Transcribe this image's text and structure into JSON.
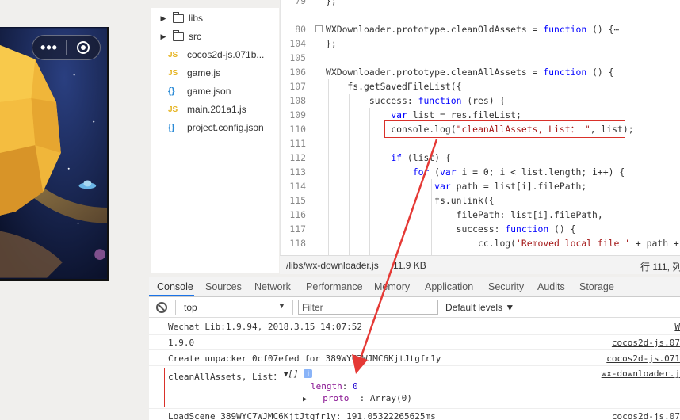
{
  "file_tree": [
    {
      "type": "folder",
      "name": "libs",
      "icon": "folder-icon"
    },
    {
      "type": "folder",
      "name": "src",
      "icon": "folder-icon"
    },
    {
      "type": "js",
      "name": "cocos2d-js.071b...",
      "badge": "JS"
    },
    {
      "type": "js",
      "name": "game.js",
      "badge": "JS"
    },
    {
      "type": "json",
      "name": "game.json",
      "badge": "{}"
    },
    {
      "type": "js",
      "name": "main.201a1.js",
      "badge": "JS"
    },
    {
      "type": "json",
      "name": "project.config.json",
      "badge": "{}"
    }
  ],
  "editor": {
    "lines": [
      {
        "n": "79",
        "code": "};"
      },
      {
        "n": "80",
        "code": "WXDownloader.prototype.cleanOldAssets = function () {⋯"
      },
      {
        "n": "104",
        "code": "};"
      },
      {
        "n": "105",
        "code": ""
      },
      {
        "n": "106",
        "code": "WXDownloader.prototype.cleanAllAssets = function () {"
      },
      {
        "n": "107",
        "code": "    fs.getSavedFileList({"
      },
      {
        "n": "108",
        "code": "        success: function (res) {"
      },
      {
        "n": "109",
        "code": "            var list = res.fileList;"
      },
      {
        "n": "110",
        "code": "            console.log(\"cleanAllAssets, List： \", list);"
      },
      {
        "n": "111",
        "code": ""
      },
      {
        "n": "112",
        "code": "            if (list) {"
      },
      {
        "n": "113",
        "code": "                for (var i = 0; i < list.length; i++) {"
      },
      {
        "n": "114",
        "code": "                    var path = list[i].filePath;"
      },
      {
        "n": "115",
        "code": "                    fs.unlink({"
      },
      {
        "n": "116",
        "code": "                        filePath: list[i].filePath,"
      },
      {
        "n": "117",
        "code": "                        success: function () {"
      },
      {
        "n": "118",
        "code": "                            cc.log('Removed local file ' + path + '"
      }
    ],
    "status": {
      "path": "/libs/wx-downloader.js",
      "size": "11.9 KB",
      "position": "行 111, 列"
    }
  },
  "devtools": {
    "tabs": [
      "Console",
      "Sources",
      "Network",
      "Performance",
      "Memory",
      "Application",
      "Security",
      "Audits",
      "Storage"
    ],
    "active_tab": "Console",
    "context": "top",
    "filter_placeholder": "Filter",
    "levels": "Default levels",
    "logs": [
      {
        "msg": "Wechat Lib:1.9.94, 2018.3.15 14:07:52",
        "src": "W"
      },
      {
        "msg": "1.9.0",
        "src": "cocos2d-js.07"
      },
      {
        "msg": "Create unpacker 0cf07efed for 389WYC7WJMC6KjtJtgfr1y",
        "src": "cocos2d-js.071"
      },
      {
        "msg": "cleanAllAssets, List：",
        "src": "wx-downloader.j"
      },
      {
        "msg": "LoadScene 389WYC7WJMC6KjtJtgfr1y: 191.05322265625ms",
        "src": "cocos2d-js.07"
      }
    ],
    "expanded": {
      "summary": "[]",
      "length_key": "length",
      "length_value": "0",
      "proto_key": "__proto__",
      "proto_value": "Array(0)"
    }
  },
  "colors": {
    "accent": "#1a73e8",
    "highlight": "#d9312a",
    "keyword": "#0000ff",
    "string": "#a31515"
  }
}
